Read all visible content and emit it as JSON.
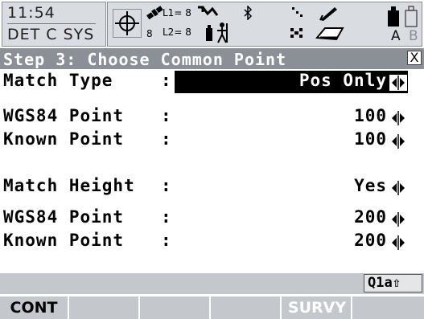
{
  "status_bar": {
    "time": "11:54",
    "coord_system_abbrev": "DET C SYS",
    "satellites_top": "8",
    "satellites_bottom": "8",
    "l1_label": "L1= 8",
    "l2_label": "L2= 8",
    "input_mode": "A",
    "input_mode_secondary": "B",
    "icons": [
      "position-crosshair-icon",
      "satellite-icon",
      "rtk-link-icon",
      "rover-person-icon",
      "bluetooth-icon",
      "point-icon",
      "line-icon",
      "stylus-icon",
      "card-icon",
      "battery-icon"
    ]
  },
  "dialog": {
    "title": "Step 3: Choose Common Point",
    "close_label": "X"
  },
  "fields": [
    {
      "label": "Match Type",
      "colon": ":",
      "value": "Pos Only",
      "active": true
    },
    {
      "label": "WGS84 Point",
      "colon": ":",
      "value": "100",
      "active": false
    },
    {
      "label": "Known Point",
      "colon": ":",
      "value": "100",
      "active": false
    },
    {
      "label": "Match Height",
      "colon": ":",
      "value": "Yes",
      "active": false
    },
    {
      "label": "WGS84 Point",
      "colon": ":",
      "value": "200",
      "active": false
    },
    {
      "label": "Known Point",
      "colon": ":",
      "value": "200",
      "active": false
    }
  ],
  "indicator": {
    "text": "Q1a⇧"
  },
  "softkeys": [
    {
      "label": "CONT",
      "enabled": true
    },
    {
      "label": "",
      "enabled": true
    },
    {
      "label": "",
      "enabled": true
    },
    {
      "label": "",
      "enabled": true
    },
    {
      "label": "SURVY",
      "enabled": false
    },
    {
      "label": "",
      "enabled": true
    }
  ],
  "colors": {
    "titlebar": "#8a9096",
    "highlight": "#000000",
    "softkey_bg": "#c4c8cc",
    "statusbox_bg": "#d9dce0"
  }
}
